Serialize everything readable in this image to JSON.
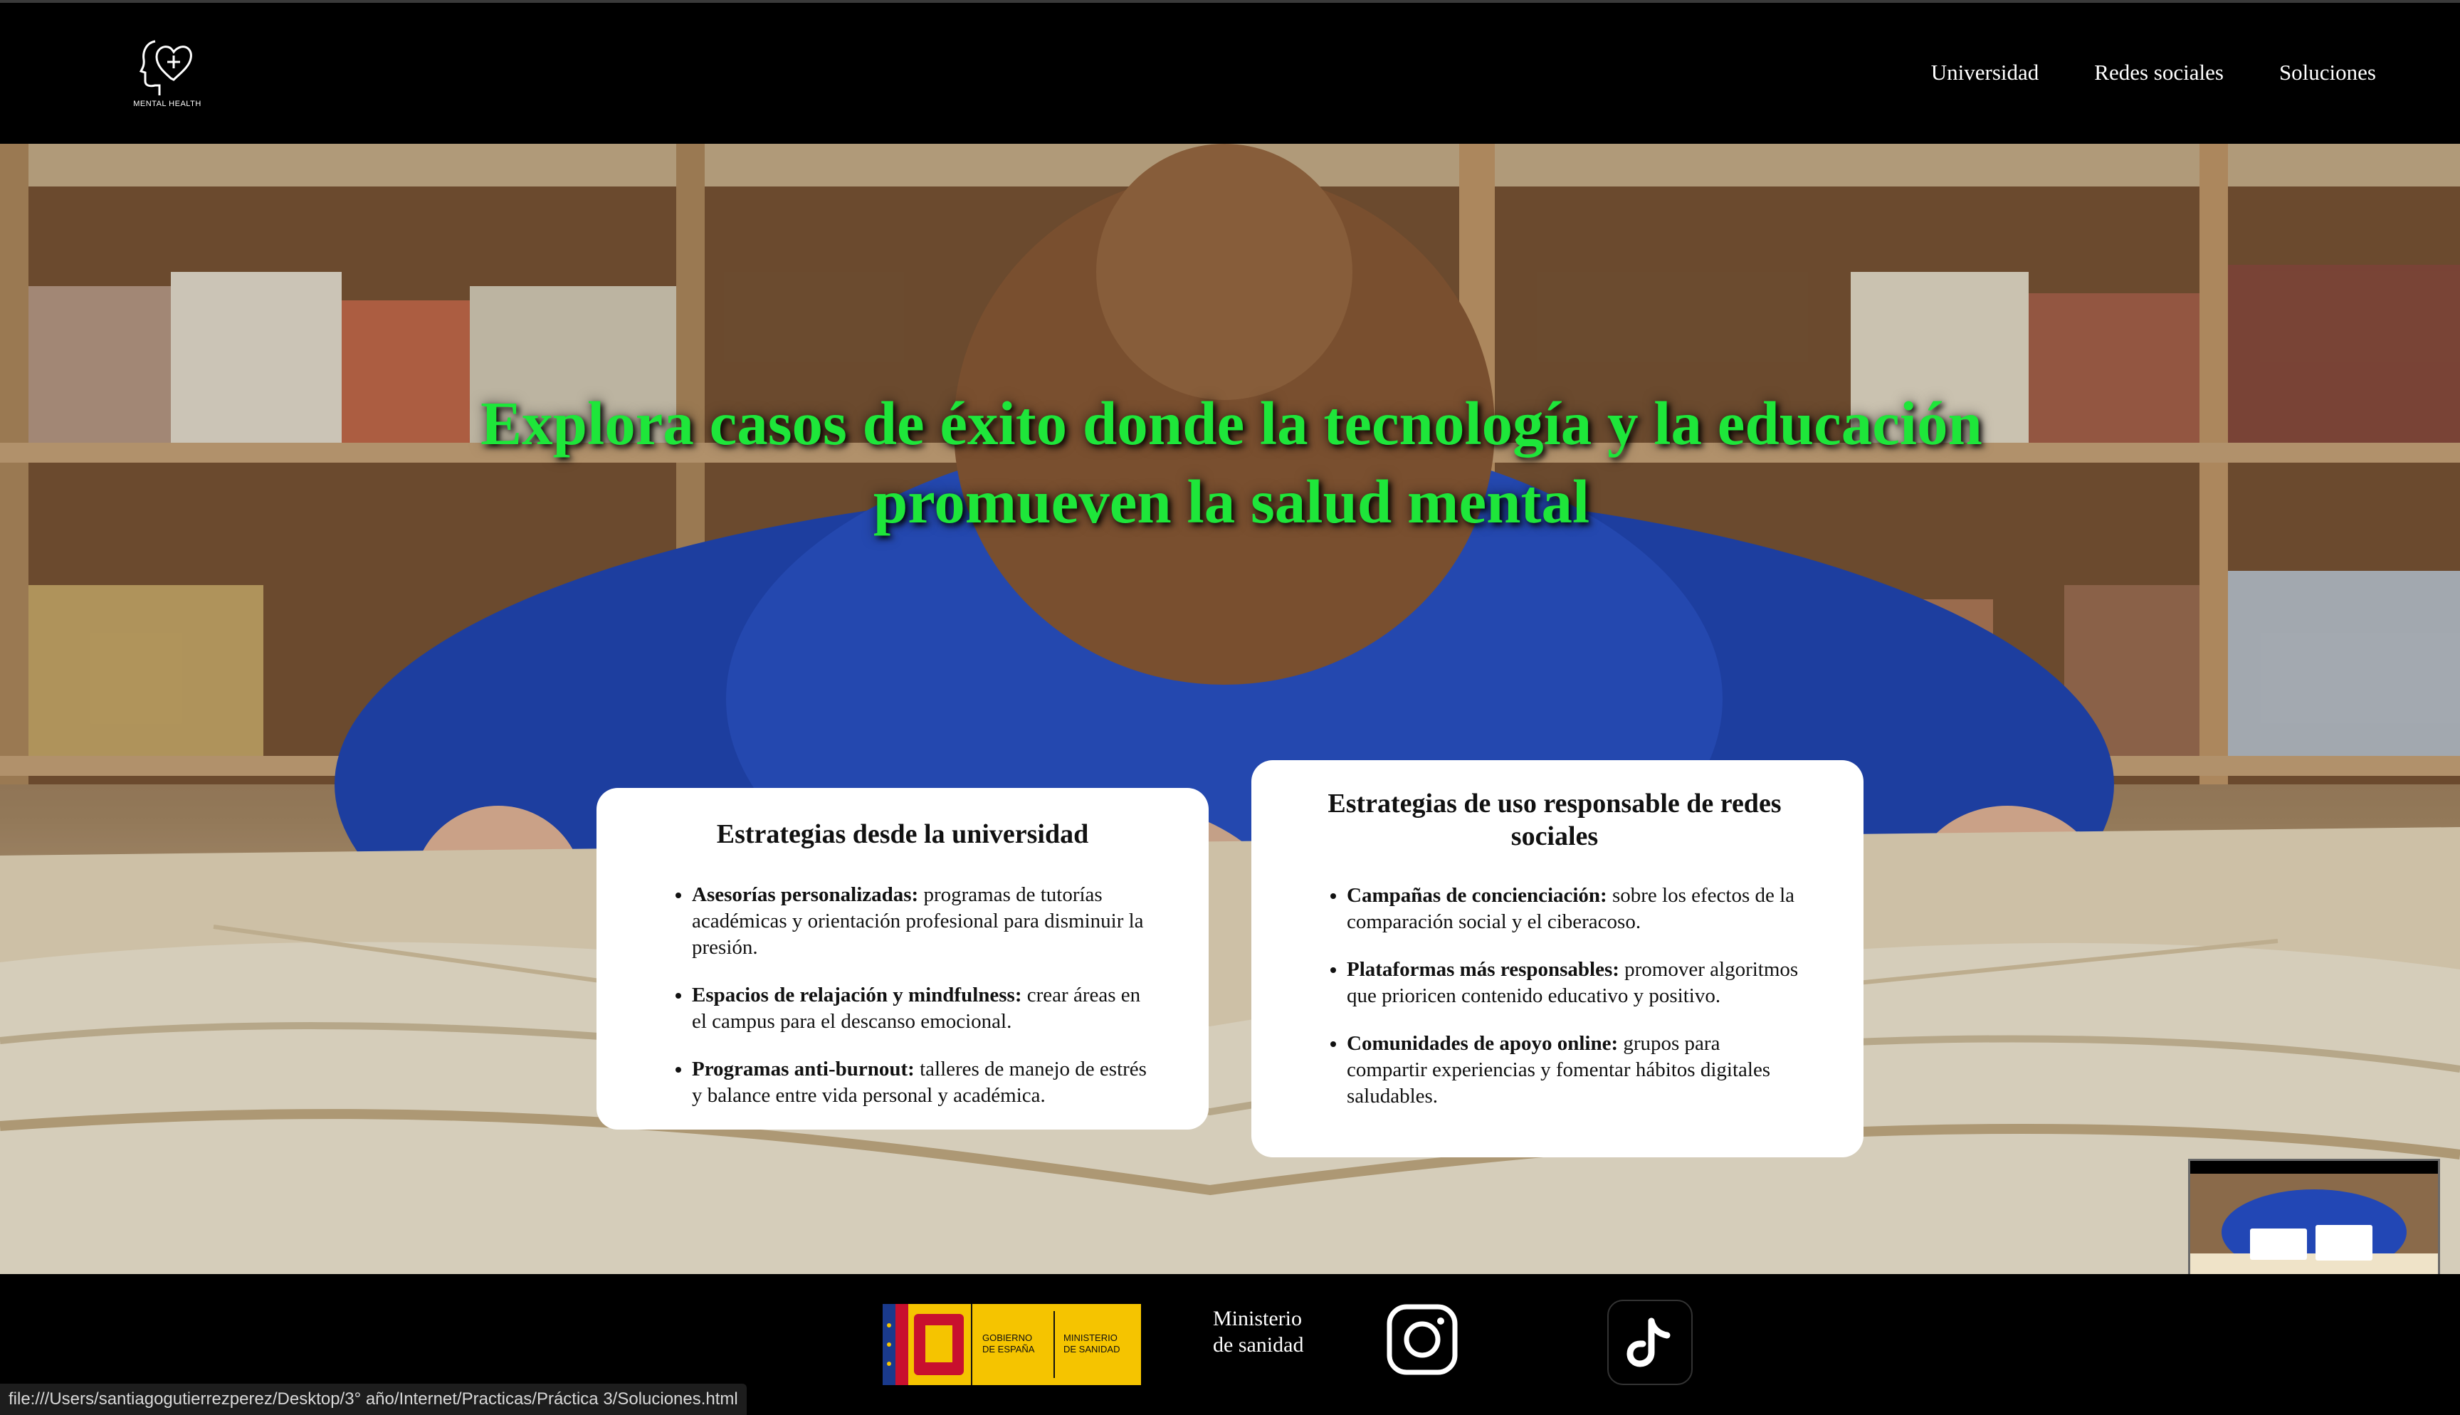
{
  "header": {
    "logo_text": "MENTAL HEALTH",
    "nav": [
      "Universidad",
      "Redes sociales",
      "Soluciones"
    ]
  },
  "hero": {
    "title": "Explora casos de éxito donde la tecnología y la educación promueven la salud mental",
    "title_color": "#1ee63a"
  },
  "cards": [
    {
      "title": "Estrategias desde la universidad",
      "items": [
        {
          "bold": "Asesorías personalizadas:",
          "text": " programas de tutorías académicas y orientación profesional para disminuir la presión."
        },
        {
          "bold": "Espacios de relajación y mindfulness:",
          "text": " crear áreas en el campus para el descanso emocional."
        },
        {
          "bold": "Programas anti-burnout:",
          "text": " talleres de manejo de estrés y balance entre vida personal y académica."
        }
      ]
    },
    {
      "title": "Estrategias de uso responsable de redes sociales",
      "items": [
        {
          "bold": "Campañas de concienciación:",
          "text": " sobre los efectos de la comparación social y el ciberacoso."
        },
        {
          "bold": "Plataformas más responsables:",
          "text": " promover algoritmos que prioricen contenido educativo y positivo."
        },
        {
          "bold": "Comunidades de apoyo online:",
          "text": " grupos para compartir experiencias y fomentar hábitos digitales saludables."
        }
      ]
    }
  ],
  "footer": {
    "gov_left": "GOBIERNO DE ESPAÑA",
    "gov_right": "MINISTERIO DE SANIDAD",
    "ministry_text": "Ministerio de sanidad",
    "icons": [
      "instagram-icon",
      "tiktok-icon"
    ]
  },
  "statusbar": {
    "url": "file:///Users/santiagogutierrezperez/Desktop/3°  año/Internet/Practicas/Práctica 3/Soluciones.html"
  }
}
